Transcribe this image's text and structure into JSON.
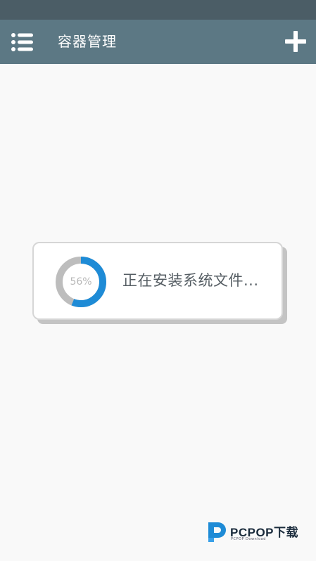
{
  "app_bar": {
    "title": "容器管理",
    "menu_icon": "list-menu-icon",
    "add_icon": "plus-icon"
  },
  "dialog": {
    "progress_percent": 56,
    "progress_label": "56%",
    "message": "正在安装系统文件..."
  },
  "watermark": {
    "name": "PCPOP下载",
    "sub": "PCPOP Download"
  },
  "colors": {
    "status_bar": "#4b5d66",
    "app_bar": "#5c7884",
    "progress_fill": "#1e8bd6",
    "progress_track": "#bdbdbd"
  }
}
